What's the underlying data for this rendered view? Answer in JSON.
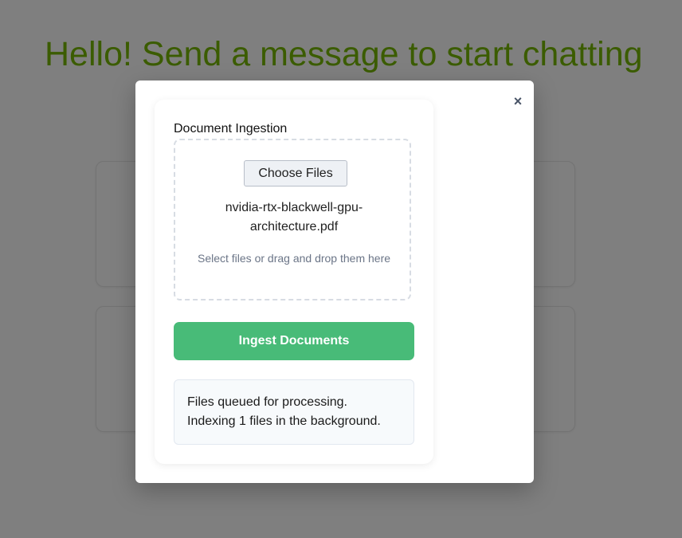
{
  "background": {
    "headline": "Hello! Send a message to start chatting"
  },
  "modal": {
    "close_label": "×",
    "panel": {
      "title": "Document Ingestion",
      "choose_files_label": "Choose Files",
      "selected_file": "nvidia-rtx-blackwell-gpu-architecture.pdf",
      "drop_hint": "Select files or drag and drop them here",
      "ingest_button_label": "Ingest Documents",
      "status_lines": [
        "Files queued for processing.",
        "Indexing 1 files in the background."
      ]
    }
  },
  "colors": {
    "headline": "#76b900",
    "ingest_button": "#48bb78",
    "overlay": "rgba(0,0,0,0.5)"
  }
}
